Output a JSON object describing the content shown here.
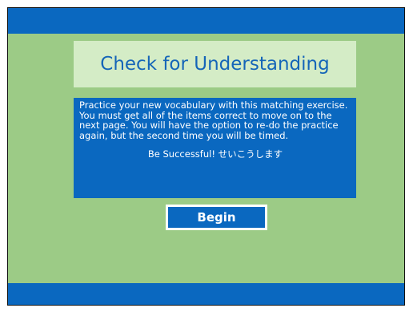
{
  "title": "Check for Understanding",
  "instructions": {
    "body": "Practice your new vocabulary with this matching exercise. You must get all of the items correct to move on to the next page. You will have the option to re-do the practice again, but the second time you will be timed.",
    "tagline": "Be Successful! せいこうします"
  },
  "begin_button": {
    "label": "Begin"
  },
  "colors": {
    "background_green": "#9ccb86",
    "bar_blue": "#0a68c0",
    "title_box": "#d4ecc6",
    "title_text": "#1565b8"
  }
}
